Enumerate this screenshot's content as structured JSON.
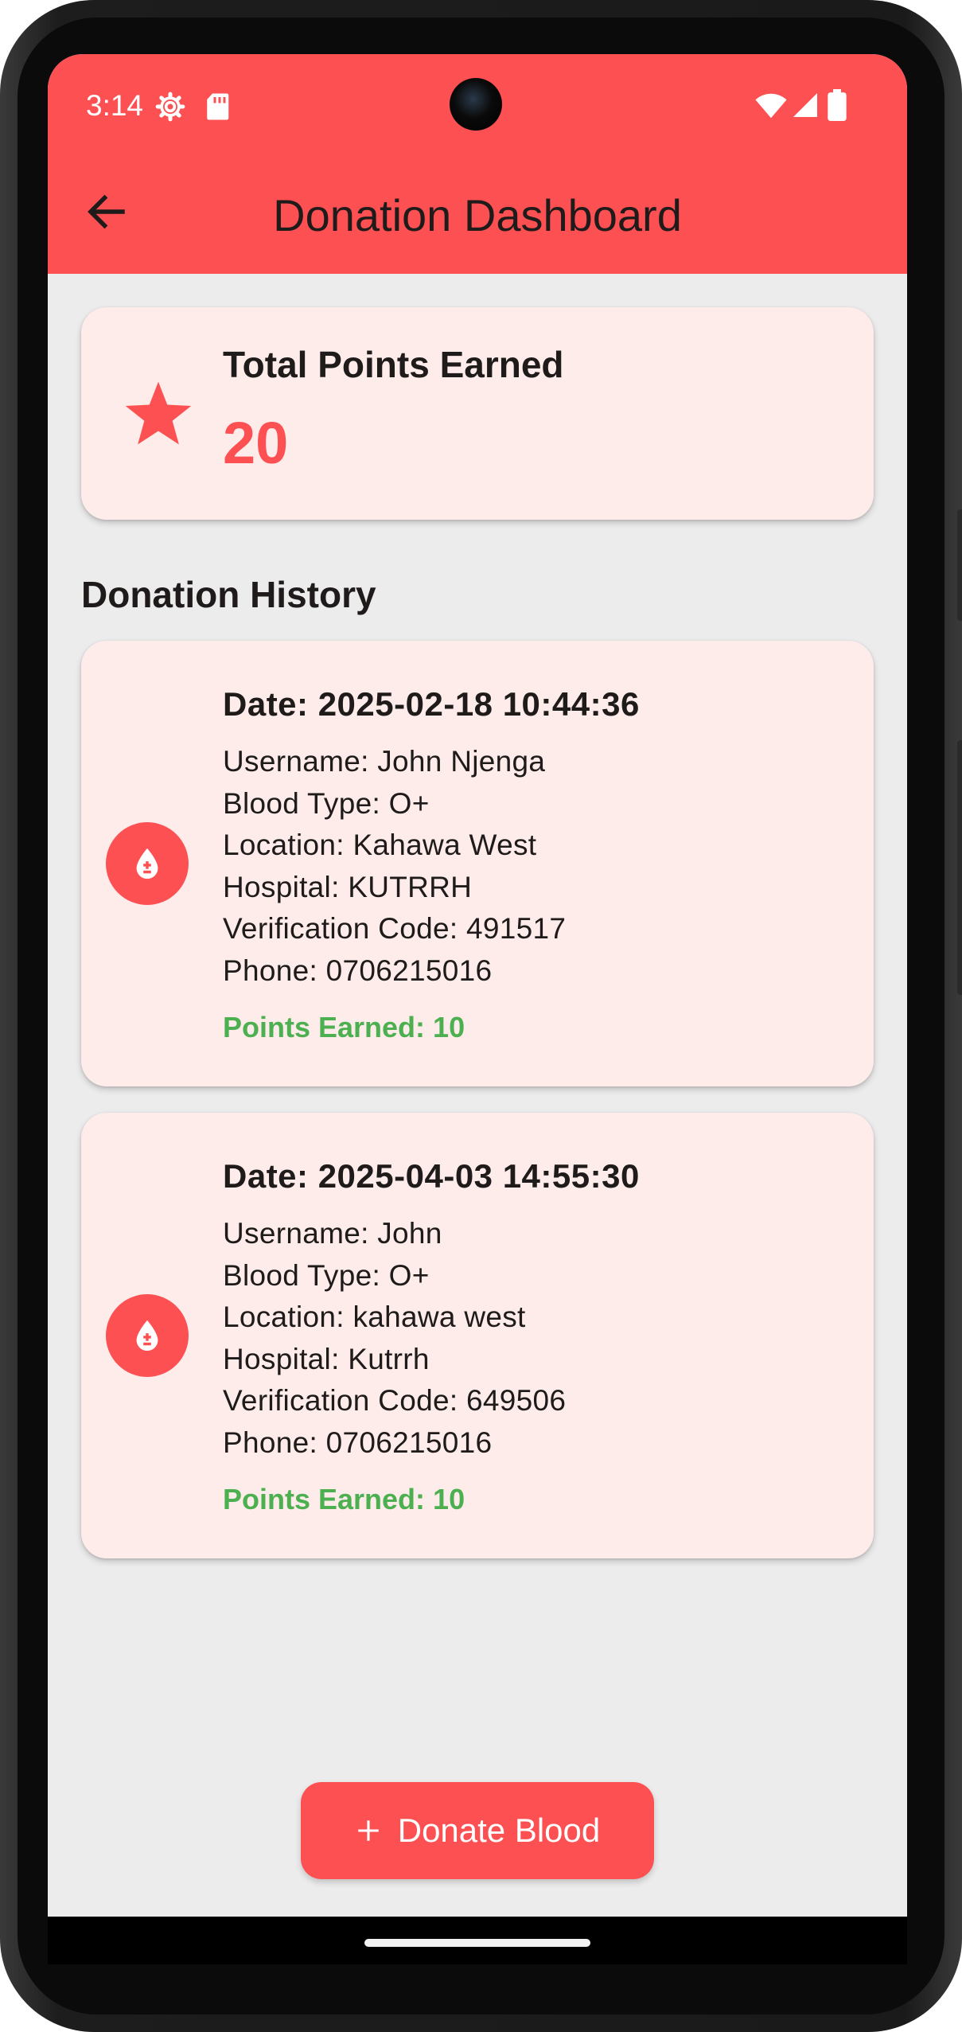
{
  "status_bar": {
    "time": "3:14",
    "icons": [
      "settings-gear-icon",
      "sd-card-icon",
      "wifi-icon",
      "signal-icon",
      "battery-icon"
    ]
  },
  "toolbar": {
    "title": "Donation Dashboard",
    "back_icon": "arrow-back-icon"
  },
  "points_card": {
    "icon": "star-icon",
    "label": "Total Points Earned",
    "value": "20"
  },
  "history": {
    "title": "Donation History",
    "items": [
      {
        "icon": "blood-drop-icon",
        "date": "Date: 2025-02-18 10:44:36",
        "username": "Username: John Njenga",
        "blood_type": "Blood Type: O+",
        "location": "Location: Kahawa West",
        "hospital": "Hospital: KUTRRH",
        "verification": "Verification Code: 491517",
        "phone": "Phone: 0706215016",
        "points": "Points Earned: 10"
      },
      {
        "icon": "blood-drop-icon",
        "date": "Date: 2025-04-03 14:55:30",
        "username": "Username: John",
        "blood_type": "Blood Type: O+",
        "location": "Location: kahawa west",
        "hospital": "Hospital: Kutrrh",
        "verification": "Verification Code: 649506",
        "phone": "Phone: 0706215016",
        "points": "Points Earned: 10"
      }
    ]
  },
  "fab": {
    "icon": "plus-icon",
    "label": "Donate Blood"
  },
  "colors": {
    "primary": "#fc5052",
    "card_bg": "#fdecea",
    "screen_bg": "#ececec",
    "points_earned": "#4caf50",
    "text": "#1f1b1b"
  }
}
